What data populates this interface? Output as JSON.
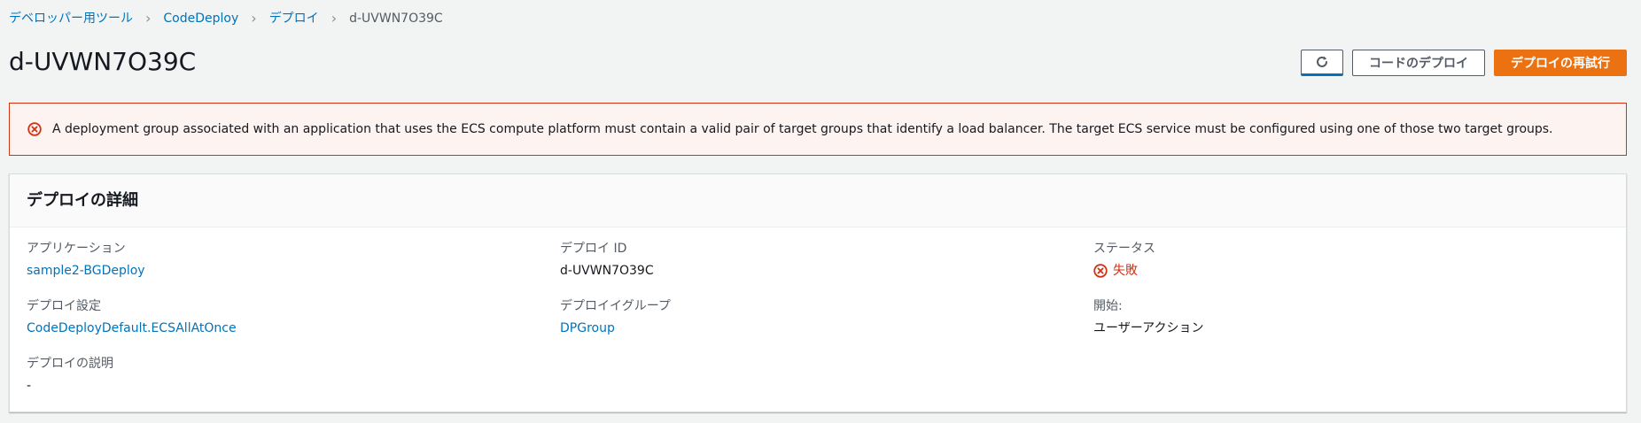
{
  "breadcrumb": {
    "items": [
      {
        "label": "デベロッパー用ツール"
      },
      {
        "label": "CodeDeploy"
      },
      {
        "label": "デプロイ"
      }
    ],
    "current": "d-UVWN7O39C"
  },
  "header": {
    "title": "d-UVWN7O39C",
    "deploy_code_label": "コードのデプロイ",
    "retry_label": "デプロイの再試行"
  },
  "alert": {
    "message": "A deployment group associated with an application that uses the ECS compute platform must contain a valid pair of target groups that identify a load balancer. The target ECS service must be configured using one of those two target groups."
  },
  "details": {
    "title": "デプロイの詳細",
    "application_label": "アプリケーション",
    "application_value": "sample2-BGDeploy",
    "deployment_id_label": "デプロイ ID",
    "deployment_id_value": "d-UVWN7O39C",
    "status_label": "ステータス",
    "status_value": "失敗",
    "config_label": "デプロイ設定",
    "config_value": "CodeDeployDefault.ECSAllAtOnce",
    "group_label": "デプロイイグループ",
    "group_value": "DPGroup",
    "start_label": "開始:",
    "start_value": "ユーザーアクション",
    "description_label": "デプロイの説明",
    "description_value": "-"
  },
  "colors": {
    "link": "#0073bb",
    "error": "#d13212",
    "primary": "#ec7211",
    "background": "#f2f3f3"
  },
  "icons": {
    "refresh": "refresh-icon",
    "error": "error-circle-icon",
    "breadcrumb_separator": "chevron-right-icon"
  }
}
